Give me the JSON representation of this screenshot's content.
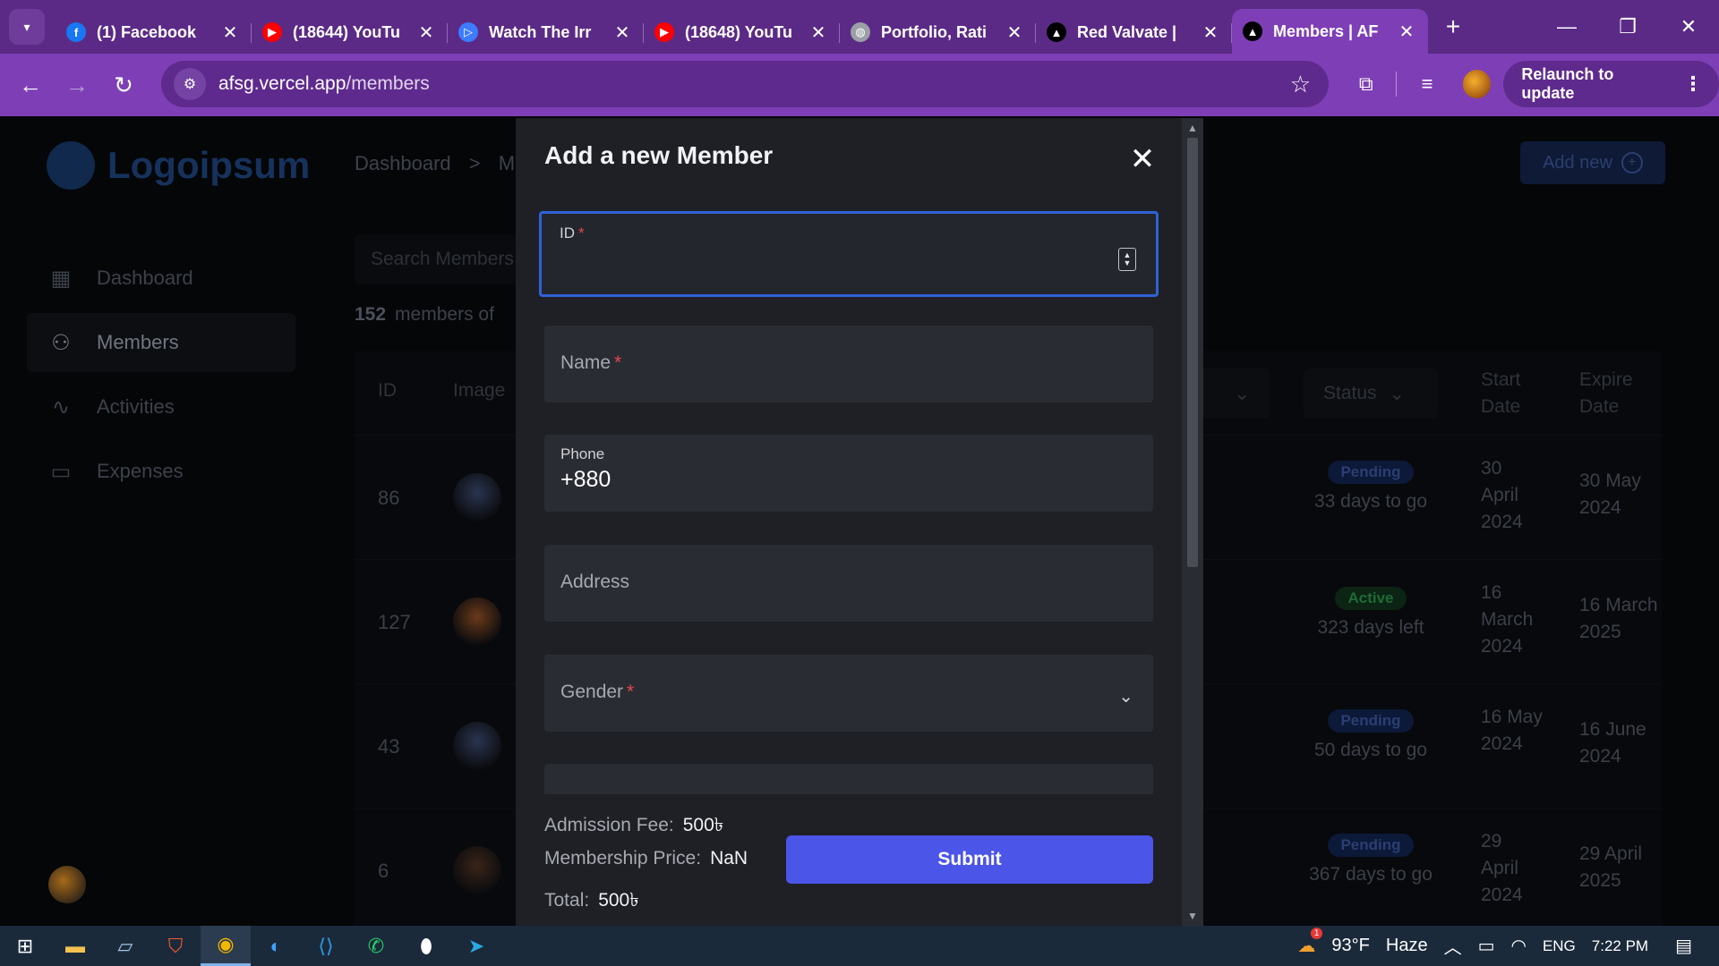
{
  "browser": {
    "tabs": [
      {
        "title": "(1) Facebook",
        "icon": "facebook-icon",
        "color": "#1877f2",
        "glyph": "f"
      },
      {
        "title": "(18644) YouTu",
        "icon": "youtube-icon",
        "color": "#ff0000",
        "glyph": "▶"
      },
      {
        "title": "Watch The Irr",
        "icon": "play-icon",
        "color": "#3d7bff",
        "glyph": "▷"
      },
      {
        "title": "(18648) YouTu",
        "icon": "youtube-icon",
        "color": "#ff0000",
        "glyph": "▶"
      },
      {
        "title": "Portfolio, Rati",
        "icon": "globe-icon",
        "color": "#9aa0a6",
        "glyph": "◍"
      },
      {
        "title": "Red Valvate |",
        "icon": "vercel-icon",
        "color": "#000000",
        "glyph": "▲"
      },
      {
        "title": "Members | AF",
        "icon": "vercel-icon",
        "color": "#000000",
        "glyph": "▲"
      }
    ],
    "url_host": "afsg.vercel.app",
    "url_path": "/members",
    "relaunch_label": "Relaunch to update"
  },
  "sidebar": {
    "logo": "Logoipsum",
    "items": [
      {
        "label": "Dashboard",
        "icon": "grid-icon",
        "glyph": "▦"
      },
      {
        "label": "Members",
        "icon": "users-icon",
        "glyph": "⚇"
      },
      {
        "label": "Activities",
        "icon": "activity-icon",
        "glyph": "∿"
      },
      {
        "label": "Expenses",
        "icon": "wallet-icon",
        "glyph": "▭"
      }
    ]
  },
  "header": {
    "crumb_root": "Dashboard",
    "crumb_sep": ">",
    "crumb_current": "Me",
    "add_new_label": "Add new"
  },
  "members": {
    "search_placeholder": "Search Members",
    "count": "152",
    "count_text": "members of",
    "columns": {
      "id": "ID",
      "image": "Image",
      "status": "Status",
      "start": "Start Date",
      "expire": "Expire Date"
    },
    "rows": [
      {
        "id": "86",
        "status": "Pending",
        "status_type": "pending",
        "left": "33 days to go",
        "start": "30 April 2024",
        "expire": "30 May 2024",
        "avatar_color": "#2b3550"
      },
      {
        "id": "127",
        "status": "Active",
        "status_type": "active",
        "left": "323 days left",
        "start": "16 March 2024",
        "expire": "16 March 2025",
        "avatar_color": "#6b3a1a"
      },
      {
        "id": "43",
        "status": "Pending",
        "status_type": "pending",
        "left": "50 days to go",
        "start": "16 May 2024",
        "expire": "16 June 2024",
        "avatar_color": "#2b3550"
      },
      {
        "id": "6",
        "status": "Pending",
        "status_type": "pending",
        "left": "367 days to go",
        "start": "29 April 2024",
        "expire": "29 April 2025",
        "avatar_color": "#3a2418"
      }
    ]
  },
  "modal": {
    "title": "Add a new Member",
    "fields": {
      "id_label": "ID",
      "name_label": "Name",
      "phone_label": "Phone",
      "phone_value": "+880",
      "address_label": "Address",
      "gender_label": "Gender",
      "required_mark": "*"
    },
    "admission_fee_label": "Admission Fee:",
    "admission_fee_value": "500৳",
    "membership_price_label": "Membership Price:",
    "membership_price_value": "NaN",
    "total_label": "Total:",
    "total_value": "500৳",
    "submit_label": "Submit"
  },
  "taskbar": {
    "weather_temp": "93°F",
    "weather_text": "Haze",
    "weather_badge": "1",
    "lang": "ENG",
    "time": "7:22 PM"
  }
}
